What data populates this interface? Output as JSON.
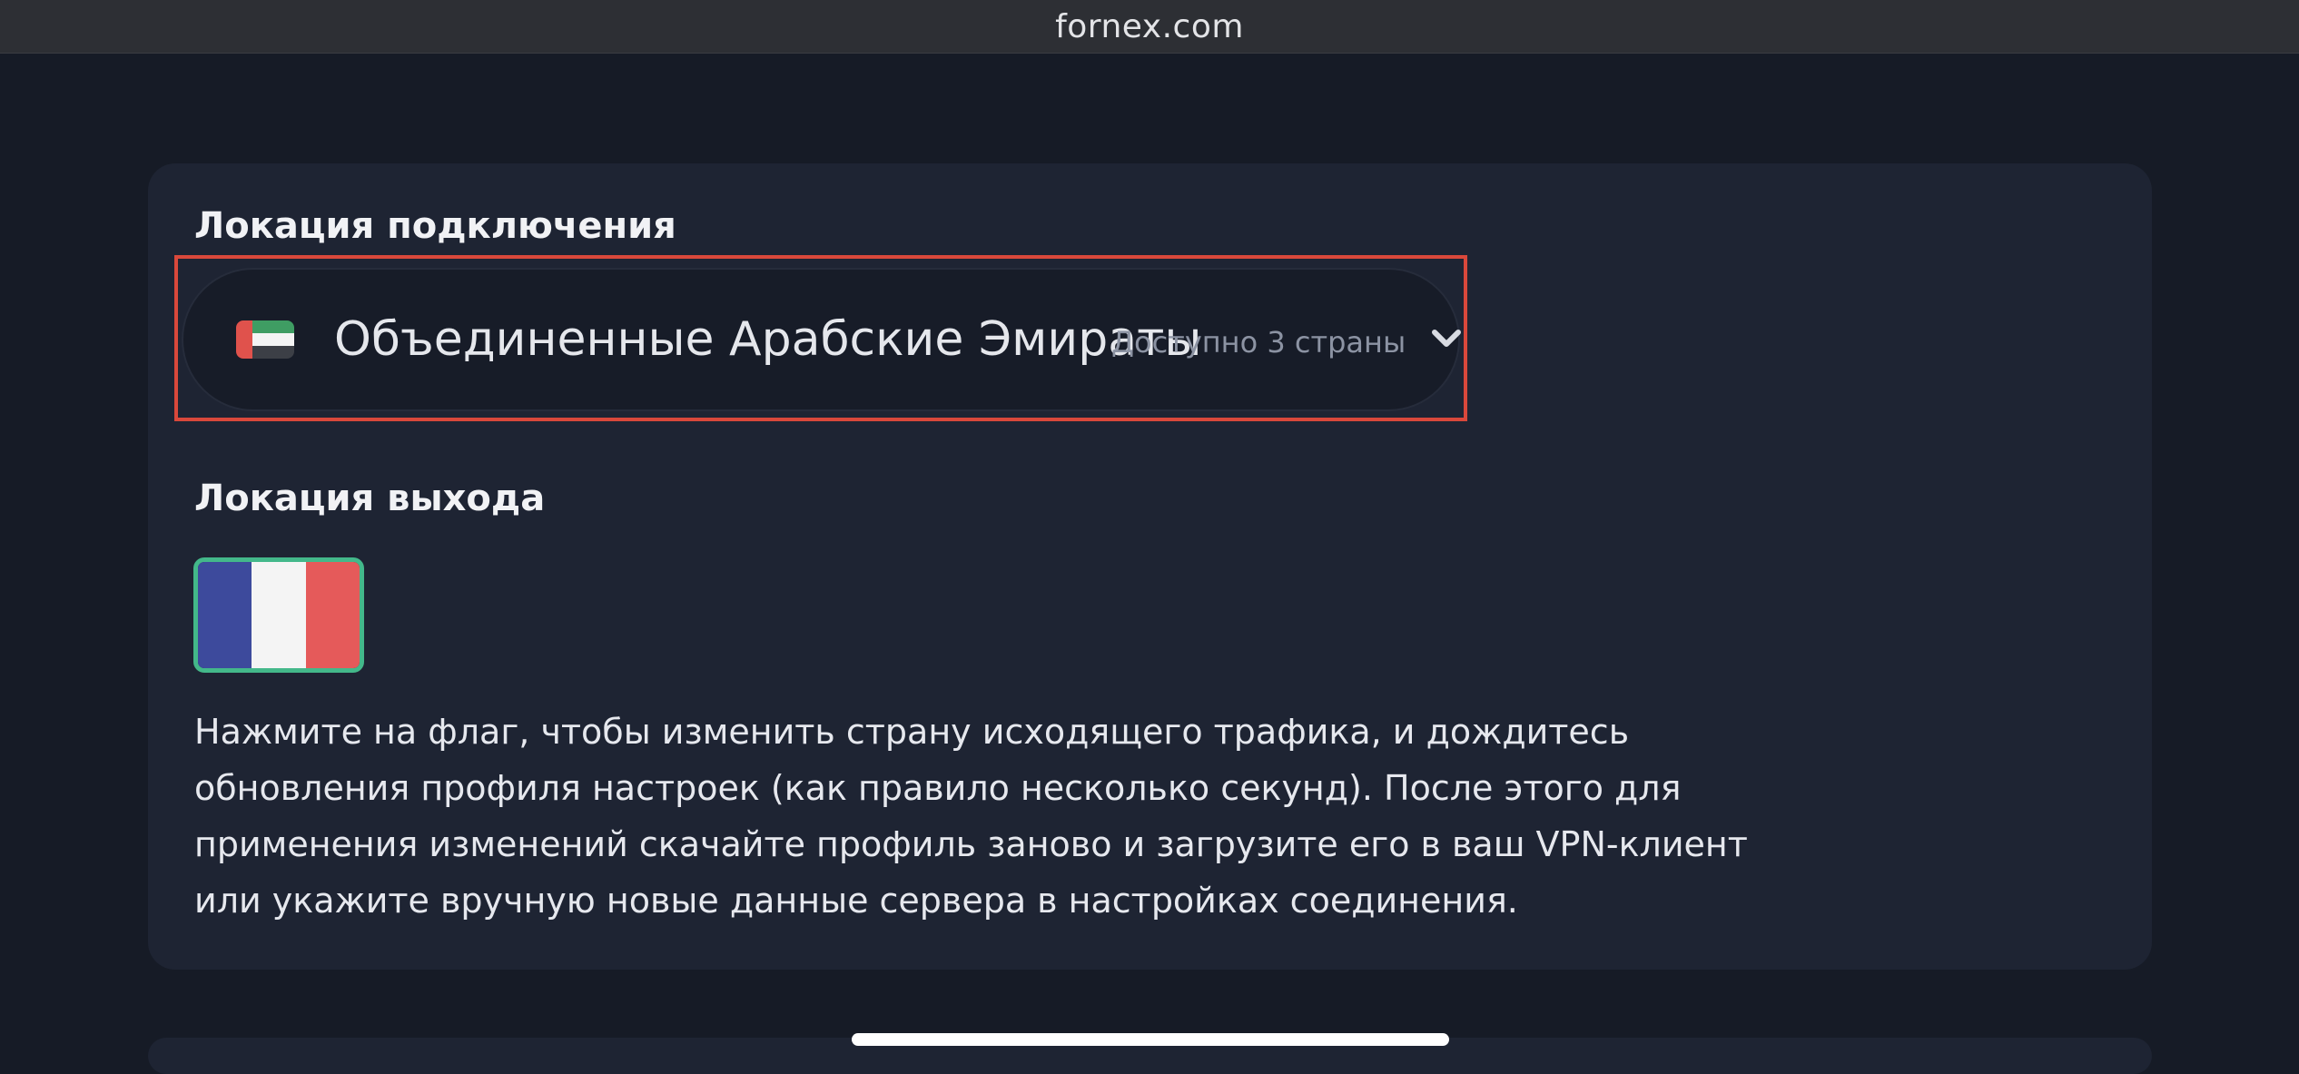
{
  "browser": {
    "url": "fornex.com"
  },
  "connection": {
    "title": "Локация подключения",
    "selected_country": "Объединенные Арабские Эмираты",
    "available_text": "Доступно 3 страны",
    "flag_icon": "uae-flag-icon",
    "dropdown_icon": "chevron-down-icon"
  },
  "exit": {
    "title": "Локация выхода",
    "flag_icon": "france-flag-icon",
    "selected_border_color": "#43b88a",
    "description_lines": [
      "Нажмите на флаг, чтобы изменить страну исходящего трафика, и дождитесь",
      "обновления профиля настроек (как правило несколько секунд). После этого для",
      "применения изменений скачайте профиль заново и загрузите его в ваш VPN-клиент",
      "или укажите вручную новые данные сервера в настройках соединения."
    ]
  },
  "colors": {
    "background": "#161b26",
    "card": "#1e2433",
    "highlight": "#d9483b"
  }
}
